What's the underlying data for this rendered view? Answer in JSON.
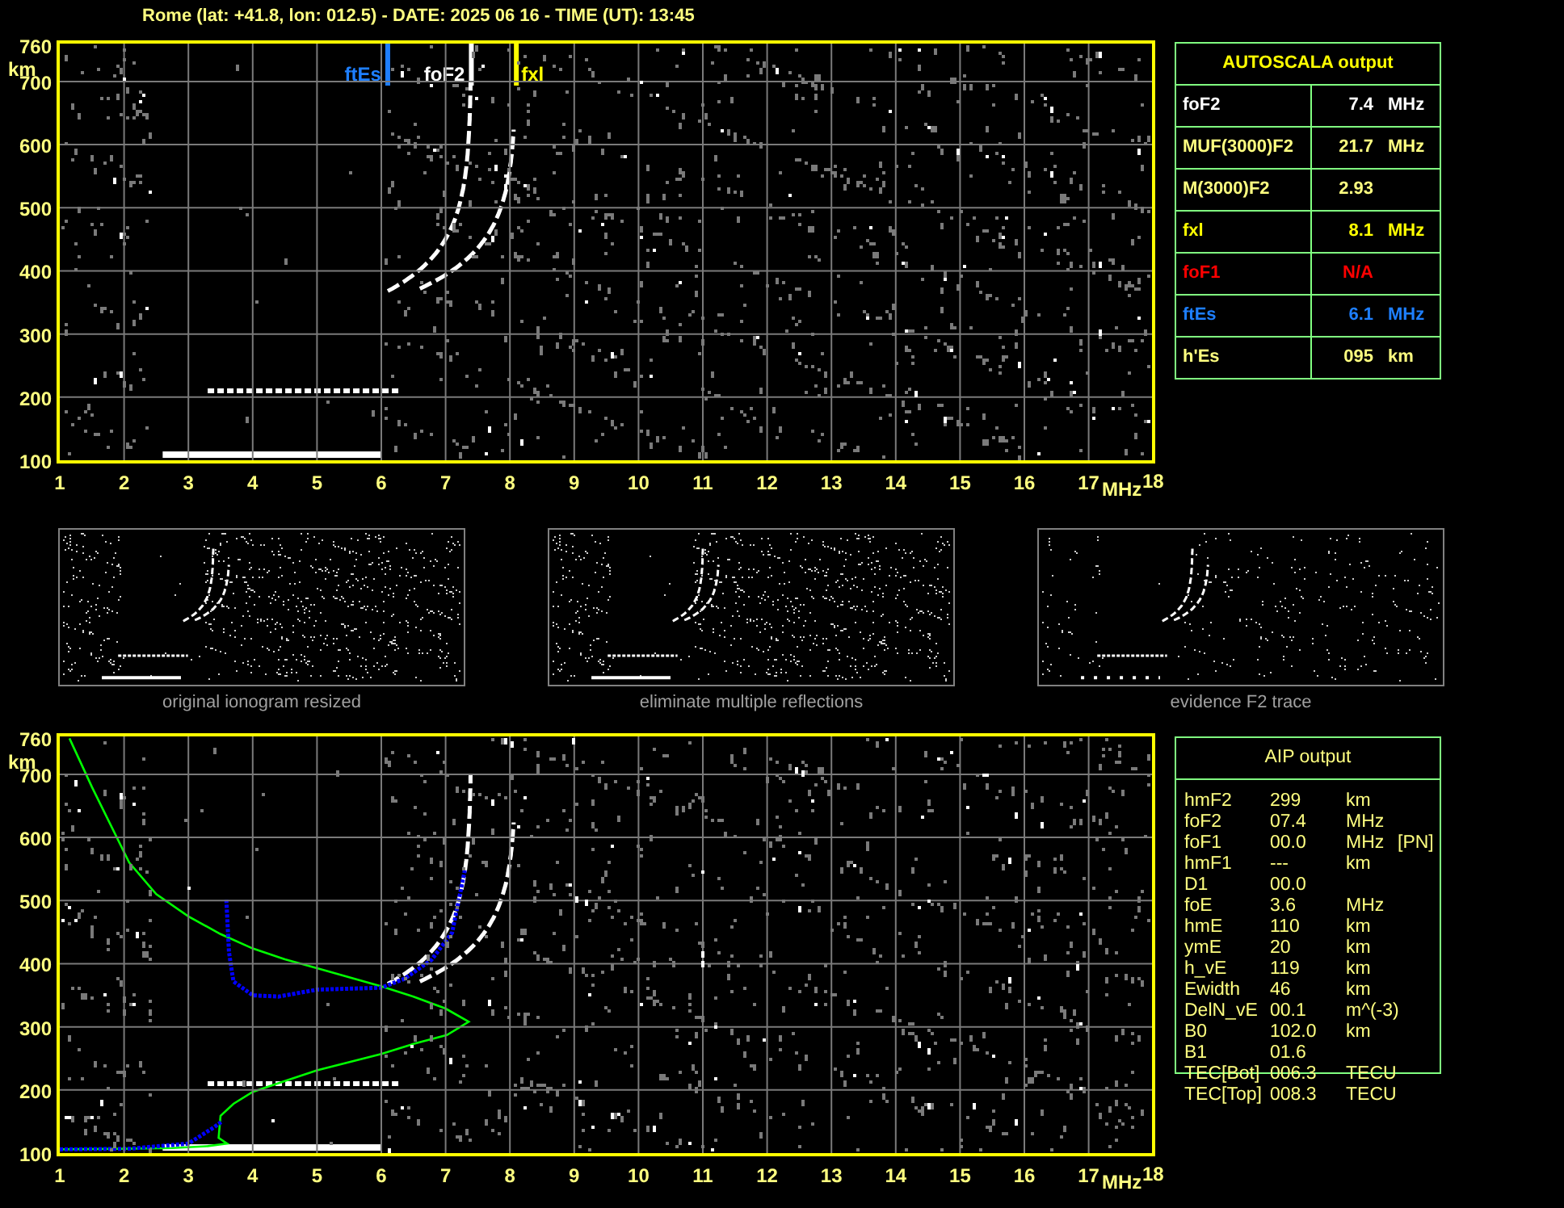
{
  "header": {
    "title": "Rome (lat: +41.8, lon: 012.5) - DATE: 2025 06 16 - TIME (UT): 13:45"
  },
  "ionogram": {
    "kind": "ionogram",
    "y_ticks": [
      "760",
      "700",
      "600",
      "500",
      "400",
      "300",
      "200",
      "100"
    ],
    "y_unit": "km",
    "x_ticks": [
      "1",
      "2",
      "3",
      "4",
      "5",
      "6",
      "7",
      "8",
      "9",
      "10",
      "11",
      "12",
      "13",
      "14",
      "15",
      "16",
      "17"
    ],
    "x_unit": "MHz",
    "x_end": "18",
    "markers": [
      {
        "label": "ftEs",
        "color": "#1e7fff"
      },
      {
        "label": "foF2",
        "color": "#ffffff"
      },
      {
        "label": "fxl",
        "color": "#ffff00"
      }
    ]
  },
  "autoscala": {
    "title": "AUTOSCALA output",
    "rows": [
      {
        "label": "foF2",
        "value": "7.4",
        "unit": "MHz",
        "color": "#ffffff"
      },
      {
        "label": "MUF(3000)F2",
        "value": "21.7",
        "unit": "MHz",
        "color": "#ffff80"
      },
      {
        "label": "M(3000)F2",
        "value": "2.93",
        "color": "#ffff80"
      },
      {
        "label": "fxl",
        "value": "8.1",
        "unit": "MHz",
        "color": "#ffff00"
      },
      {
        "label": "foF1",
        "value": "N/A",
        "color": "#ff0000"
      },
      {
        "label": "ftEs",
        "value": "6.1",
        "unit": "MHz",
        "color": "#1e7fff"
      },
      {
        "label": "h'Es",
        "value": "095",
        "unit": "km",
        "color": "#ffff80"
      }
    ]
  },
  "thumbnails": [
    {
      "caption": "original ionogram resized"
    },
    {
      "caption": "eliminate multiple reflections"
    },
    {
      "caption": "evidence F2 trace"
    }
  ],
  "profile_plot": {
    "kind": "profile",
    "y_ticks": [
      "760",
      "700",
      "600",
      "500",
      "400",
      "300",
      "200",
      "100"
    ],
    "y_unit": "km",
    "x_ticks": [
      "1",
      "2",
      "3",
      "4",
      "5",
      "6",
      "7",
      "8",
      "9",
      "10",
      "11",
      "12",
      "13",
      "14",
      "15",
      "16",
      "17"
    ],
    "x_unit": "MHz",
    "x_end": "18"
  },
  "aip": {
    "title": "AIP output",
    "rows": [
      {
        "name": "hmF2",
        "value": "299",
        "unit": "km"
      },
      {
        "name": "foF2",
        "value": "07.4",
        "unit": "MHz"
      },
      {
        "name": "foF1",
        "value": "00.0",
        "unit": "MHz",
        "note": "[PN]"
      },
      {
        "name": "hmF1",
        "value": "---",
        "unit": "km"
      },
      {
        "name": "D1",
        "value": "00.0"
      },
      {
        "name": "foE",
        "value": "3.6",
        "unit": "MHz"
      },
      {
        "name": "hmE",
        "value": "110",
        "unit": "km"
      },
      {
        "name": "ymE",
        "value": "20",
        "unit": "km"
      },
      {
        "name": "h_vE",
        "value": "119",
        "unit": "km"
      },
      {
        "name": "Ewidth",
        "value": "46",
        "unit": "km"
      },
      {
        "name": "DelN_vE",
        "value": "00.1",
        "unit": "m^(-3)"
      },
      {
        "name": "B0",
        "value": "102.0",
        "unit": "km"
      },
      {
        "name": "B1",
        "value": "01.6"
      },
      {
        "name": "TEC[Bot]",
        "value": "006.3",
        "unit": "TECU"
      },
      {
        "name": "TEC[Top]",
        "value": "008.3",
        "unit": "TECU"
      }
    ]
  }
}
